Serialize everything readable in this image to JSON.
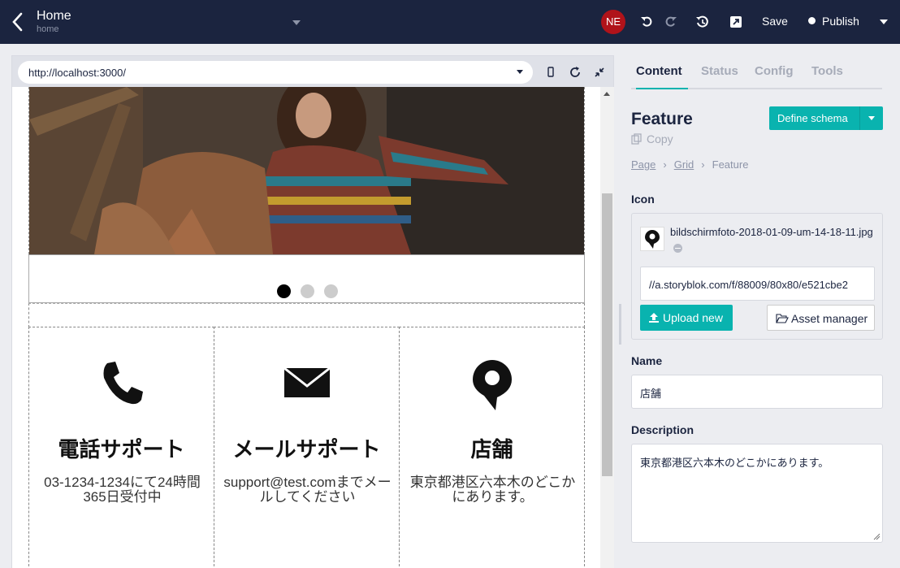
{
  "topbar": {
    "title": "Home",
    "subtitle": "home",
    "avatar_initials": "NE",
    "save_label": "Save",
    "publish_label": "Publish",
    "avatar_color": "#b0131a",
    "background": "#1b243f"
  },
  "preview": {
    "url": "http://localhost:3000/",
    "carousel_dots": [
      "active",
      "inactive",
      "inactive"
    ],
    "features": [
      {
        "icon": "phone-icon",
        "name": "電話サポート",
        "description": "03-1234-1234にて24時間365日受付中"
      },
      {
        "icon": "mail-icon",
        "name": "メールサポート",
        "description": "support@test.comまでメールしてください"
      },
      {
        "icon": "map-pin-icon",
        "name": "店舗",
        "description": "東京都港区六本木のどこかにあります。"
      }
    ]
  },
  "panel": {
    "tabs": [
      "Content",
      "Status",
      "Config",
      "Tools"
    ],
    "active_tab": "Content",
    "component_title": "Feature",
    "copy_label": "Copy",
    "define_schema_label": "Define schema",
    "breadcrumbs": [
      "Page",
      "Grid",
      "Feature"
    ],
    "icon_field": {
      "label": "Icon",
      "filename": "bildschirmfoto-2018-01-09-um-14-18-11.jpg",
      "url_value": "//a.storyblok.com/f/88009/80x80/e521cbe2",
      "upload_label": "Upload new",
      "asset_manager_label": "Asset manager"
    },
    "name_field": {
      "label": "Name",
      "value": "店舗"
    },
    "description_field": {
      "label": "Description",
      "value": "東京都港区六本木のどこかにあります。"
    },
    "accent_color": "#09b3af"
  }
}
